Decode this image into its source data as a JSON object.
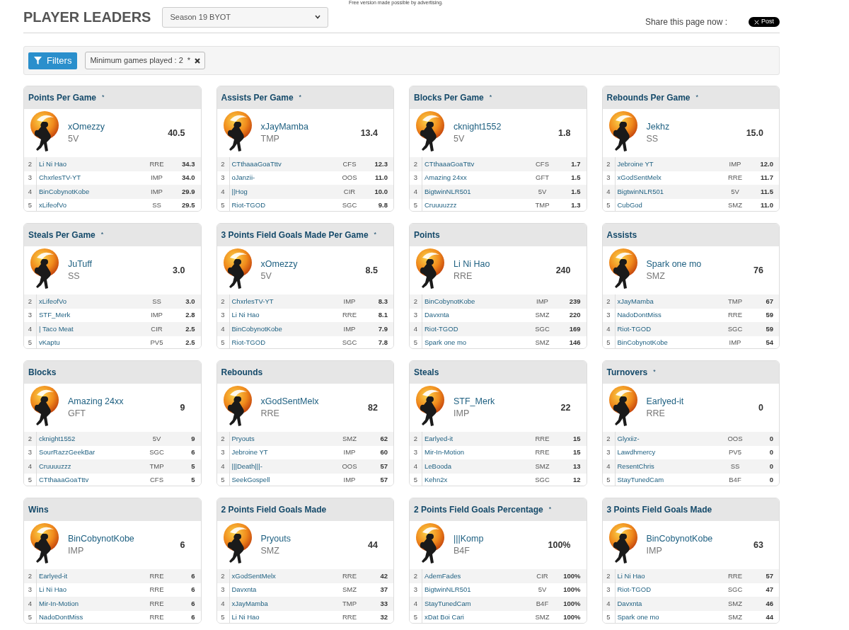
{
  "ad_notice": "Free version made possible by advertising.",
  "page_title": "PLAYER LEADERS",
  "season_select": {
    "value": "Season 19 BYOT"
  },
  "share": {
    "label": "Share this page now :",
    "button": "Post"
  },
  "filters": {
    "button": "Filters",
    "chips": [
      {
        "label": "Minimum games played : 2",
        "mark": "*"
      }
    ]
  },
  "leaders": [
    {
      "title": "Points Per Game",
      "mark": "*",
      "leader": {
        "name": "xOmezzy",
        "team": "5V",
        "value": "40.5"
      },
      "rows": [
        {
          "rank": "2",
          "name": "Li Ni Hao",
          "team": "RRE",
          "value": "34.3"
        },
        {
          "rank": "3",
          "name": "ChxrlesTV-YT",
          "team": "IMP",
          "value": "34.0"
        },
        {
          "rank": "4",
          "name": "BinCobynotKobe",
          "team": "IMP",
          "value": "29.9"
        },
        {
          "rank": "5",
          "name": "xLifeofVo",
          "team": "SS",
          "value": "29.5"
        }
      ]
    },
    {
      "title": "Assists Per Game",
      "mark": "*",
      "leader": {
        "name": "xJayMamba",
        "team": "TMP",
        "value": "13.4"
      },
      "rows": [
        {
          "rank": "2",
          "name": "CTthaaaGoaTttv",
          "team": "CFS",
          "value": "12.3"
        },
        {
          "rank": "3",
          "name": "oJanzii-",
          "team": "OOS",
          "value": "11.0"
        },
        {
          "rank": "4",
          "name": "||Hog",
          "team": "CIR",
          "value": "10.0"
        },
        {
          "rank": "5",
          "name": "Riot-TGOD",
          "team": "SGC",
          "value": "9.8"
        }
      ]
    },
    {
      "title": "Blocks Per Game",
      "mark": "*",
      "leader": {
        "name": "cknight1552",
        "team": "5V",
        "value": "1.8"
      },
      "rows": [
        {
          "rank": "2",
          "name": "CTthaaaGoaTttv",
          "team": "CFS",
          "value": "1.7"
        },
        {
          "rank": "3",
          "name": "Amazing 24xx",
          "team": "GFT",
          "value": "1.5"
        },
        {
          "rank": "4",
          "name": "BigtwinNLR501",
          "team": "5V",
          "value": "1.5"
        },
        {
          "rank": "5",
          "name": "Cruuuuzzz",
          "team": "TMP",
          "value": "1.3"
        }
      ]
    },
    {
      "title": "Rebounds Per Game",
      "mark": "*",
      "leader": {
        "name": "Jekhz",
        "team": "SS",
        "value": "15.0"
      },
      "rows": [
        {
          "rank": "2",
          "name": "Jebroine YT",
          "team": "IMP",
          "value": "12.0"
        },
        {
          "rank": "3",
          "name": "xGodSentMelx",
          "team": "RRE",
          "value": "11.7"
        },
        {
          "rank": "4",
          "name": "BigtwinNLR501",
          "team": "5V",
          "value": "11.5"
        },
        {
          "rank": "5",
          "name": "CubGod",
          "team": "SMZ",
          "value": "11.0"
        }
      ]
    },
    {
      "title": "Steals Per Game",
      "mark": "*",
      "leader": {
        "name": "JuTuff",
        "team": "SS",
        "value": "3.0"
      },
      "rows": [
        {
          "rank": "2",
          "name": "xLifeofVo",
          "team": "SS",
          "value": "3.0"
        },
        {
          "rank": "3",
          "name": "STF_Merk",
          "team": "IMP",
          "value": "2.8"
        },
        {
          "rank": "4",
          "name": "| Taco Meat",
          "team": "CIR",
          "value": "2.5"
        },
        {
          "rank": "5",
          "name": "vKaptu",
          "team": "PV5",
          "value": "2.5"
        }
      ]
    },
    {
      "title": "3 Points Field Goals Made Per Game",
      "mark": "*",
      "leader": {
        "name": "xOmezzy",
        "team": "5V",
        "value": "8.5"
      },
      "rows": [
        {
          "rank": "2",
          "name": "ChxrlesTV-YT",
          "team": "IMP",
          "value": "8.3"
        },
        {
          "rank": "3",
          "name": "Li Ni Hao",
          "team": "RRE",
          "value": "8.1"
        },
        {
          "rank": "4",
          "name": "BinCobynotKobe",
          "team": "IMP",
          "value": "7.9"
        },
        {
          "rank": "5",
          "name": "Riot-TGOD",
          "team": "SGC",
          "value": "7.8"
        }
      ]
    },
    {
      "title": "Points",
      "leader": {
        "name": "Li Ni Hao",
        "team": "RRE",
        "value": "240"
      },
      "rows": [
        {
          "rank": "2",
          "name": "BinCobynotKobe",
          "team": "IMP",
          "value": "239"
        },
        {
          "rank": "3",
          "name": "Davxnta",
          "team": "SMZ",
          "value": "220"
        },
        {
          "rank": "4",
          "name": "Riot-TGOD",
          "team": "SGC",
          "value": "169"
        },
        {
          "rank": "5",
          "name": "Spark one mo",
          "team": "SMZ",
          "value": "146"
        }
      ]
    },
    {
      "title": "Assists",
      "leader": {
        "name": "Spark one mo",
        "team": "SMZ",
        "value": "76"
      },
      "rows": [
        {
          "rank": "2",
          "name": "xJayMamba",
          "team": "TMP",
          "value": "67"
        },
        {
          "rank": "3",
          "name": "NadoDontMiss",
          "team": "RRE",
          "value": "59"
        },
        {
          "rank": "4",
          "name": "Riot-TGOD",
          "team": "SGC",
          "value": "59"
        },
        {
          "rank": "5",
          "name": "BinCobynotKobe",
          "team": "IMP",
          "value": "54"
        }
      ]
    },
    {
      "title": "Blocks",
      "leader": {
        "name": "Amazing 24xx",
        "team": "GFT",
        "value": "9"
      },
      "rows": [
        {
          "rank": "2",
          "name": "cknight1552",
          "team": "5V",
          "value": "9"
        },
        {
          "rank": "3",
          "name": "SourRazzGeekBar",
          "team": "SGC",
          "value": "6"
        },
        {
          "rank": "4",
          "name": "Cruuuuzzz",
          "team": "TMP",
          "value": "5"
        },
        {
          "rank": "5",
          "name": "CTthaaaGoaTttv",
          "team": "CFS",
          "value": "5"
        }
      ]
    },
    {
      "title": "Rebounds",
      "leader": {
        "name": "xGodSentMelx",
        "team": "RRE",
        "value": "82"
      },
      "rows": [
        {
          "rank": "2",
          "name": "Pryouts",
          "team": "SMZ",
          "value": "62"
        },
        {
          "rank": "3",
          "name": "Jebroine YT",
          "team": "IMP",
          "value": "60"
        },
        {
          "rank": "4",
          "name": "|||Death|||-",
          "team": "OOS",
          "value": "57"
        },
        {
          "rank": "5",
          "name": "SeekGospell",
          "team": "IMP",
          "value": "57"
        }
      ]
    },
    {
      "title": "Steals",
      "leader": {
        "name": "STF_Merk",
        "team": "IMP",
        "value": "22"
      },
      "rows": [
        {
          "rank": "2",
          "name": "Earlyed-it",
          "team": "RRE",
          "value": "15"
        },
        {
          "rank": "3",
          "name": "Mir-In-Motion",
          "team": "RRE",
          "value": "15"
        },
        {
          "rank": "4",
          "name": "LeBooda",
          "team": "SMZ",
          "value": "13"
        },
        {
          "rank": "5",
          "name": "Kehn2x",
          "team": "SGC",
          "value": "12"
        }
      ]
    },
    {
      "title": "Turnovers",
      "mark": "*",
      "leader": {
        "name": "Earlyed-it",
        "team": "RRE",
        "value": "0"
      },
      "rows": [
        {
          "rank": "2",
          "name": "Glyxiiz-",
          "team": "OOS",
          "value": "0"
        },
        {
          "rank": "3",
          "name": "Lawdhmercy",
          "team": "PV5",
          "value": "0"
        },
        {
          "rank": "4",
          "name": "ResentChris",
          "team": "SS",
          "value": "0"
        },
        {
          "rank": "5",
          "name": "StayTunedCam",
          "team": "B4F",
          "value": "0"
        }
      ]
    },
    {
      "title": "Wins",
      "leader": {
        "name": "BinCobynotKobe",
        "team": "IMP",
        "value": "6"
      },
      "rows": [
        {
          "rank": "2",
          "name": "Earlyed-it",
          "team": "RRE",
          "value": "6"
        },
        {
          "rank": "3",
          "name": "Li Ni Hao",
          "team": "RRE",
          "value": "6"
        },
        {
          "rank": "4",
          "name": "Mir-In-Motion",
          "team": "RRE",
          "value": "6"
        },
        {
          "rank": "5",
          "name": "NadoDontMiss",
          "team": "RRE",
          "value": "6"
        }
      ]
    },
    {
      "title": "2 Points Field Goals Made",
      "leader": {
        "name": "Pryouts",
        "team": "SMZ",
        "value": "44"
      },
      "rows": [
        {
          "rank": "2",
          "name": "xGodSentMelx",
          "team": "RRE",
          "value": "42"
        },
        {
          "rank": "3",
          "name": "Davxnta",
          "team": "SMZ",
          "value": "37"
        },
        {
          "rank": "4",
          "name": "xJayMamba",
          "team": "TMP",
          "value": "33"
        },
        {
          "rank": "5",
          "name": "Li Ni Hao",
          "team": "RRE",
          "value": "32"
        }
      ]
    },
    {
      "title": "2 Points Field Goals Percentage",
      "mark": "*",
      "leader": {
        "name": "|||Komp",
        "team": "B4F",
        "value": "100%"
      },
      "rows": [
        {
          "rank": "2",
          "name": "AdemFades",
          "team": "CIR",
          "value": "100%"
        },
        {
          "rank": "3",
          "name": "BigtwinNLR501",
          "team": "5V",
          "value": "100%"
        },
        {
          "rank": "4",
          "name": "StayTunedCam",
          "team": "B4F",
          "value": "100%"
        },
        {
          "rank": "5",
          "name": "xDat Boi Cari",
          "team": "SMZ",
          "value": "100%"
        }
      ]
    },
    {
      "title": "3 Points Field Goals Made",
      "leader": {
        "name": "BinCobynotKobe",
        "team": "IMP",
        "value": "63"
      },
      "rows": [
        {
          "rank": "2",
          "name": "Li Ni Hao",
          "team": "RRE",
          "value": "57"
        },
        {
          "rank": "3",
          "name": "Riot-TGOD",
          "team": "SGC",
          "value": "47"
        },
        {
          "rank": "4",
          "name": "Davxnta",
          "team": "SMZ",
          "value": "46"
        },
        {
          "rank": "5",
          "name": "Spark one mo",
          "team": "SMZ",
          "value": "44"
        }
      ]
    }
  ]
}
